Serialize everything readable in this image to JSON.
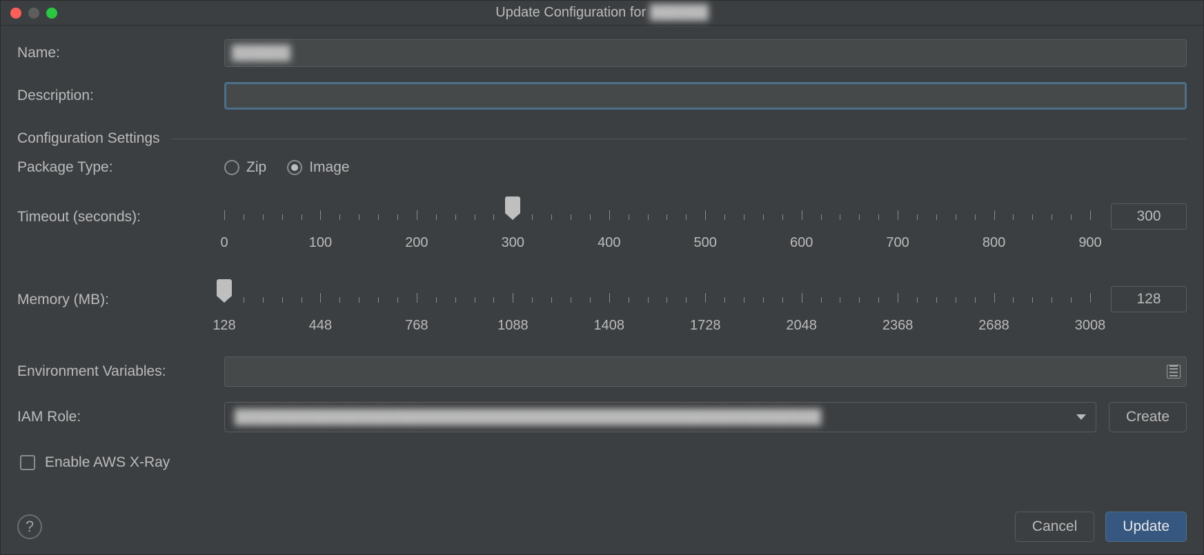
{
  "window": {
    "title_prefix": "Update Configuration for ",
    "title_name": "██████"
  },
  "fields": {
    "name_label": "Name:",
    "name_value": "██████",
    "description_label": "Description:",
    "description_value": ""
  },
  "section": {
    "title": "Configuration Settings"
  },
  "package_type": {
    "label": "Package Type:",
    "options": {
      "zip": "Zip",
      "image": "Image"
    },
    "selected": "image"
  },
  "timeout": {
    "label": "Timeout (seconds):",
    "min": 0,
    "max": 900,
    "major_labels": [
      "0",
      "100",
      "200",
      "300",
      "400",
      "500",
      "600",
      "700",
      "800",
      "900"
    ],
    "value": 300
  },
  "memory": {
    "label": "Memory (MB):",
    "min": 128,
    "max": 3008,
    "major_labels": [
      "128",
      "448",
      "768",
      "1088",
      "1408",
      "1728",
      "2048",
      "2368",
      "2688",
      "3008"
    ],
    "value": 128
  },
  "env": {
    "label": "Environment Variables:",
    "value": ""
  },
  "iam": {
    "label": "IAM Role:",
    "value": "████████████████████████████████████████████████████████████",
    "create_label": "Create"
  },
  "xray": {
    "label": "Enable AWS X-Ray",
    "checked": false
  },
  "buttons": {
    "help": "?",
    "cancel": "Cancel",
    "update": "Update"
  }
}
